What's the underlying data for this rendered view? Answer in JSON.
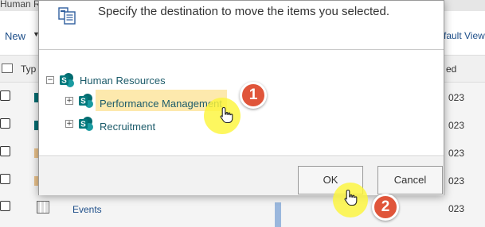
{
  "background": {
    "title_fragment": "Human R",
    "new_label": "New",
    "view_fragment": "fault View",
    "type_header": "Typ",
    "modified_header": "ed",
    "years": [
      "023",
      "023",
      "023",
      "023",
      "023"
    ],
    "events_label": "Events"
  },
  "dialog": {
    "instruction": "Specify the destination to move the items you selected.",
    "tree": {
      "root": {
        "label": "Human Resources",
        "expanded": true
      },
      "children": [
        {
          "label": "Performance Management",
          "selected": true
        },
        {
          "label": "Recruitment",
          "selected": false
        }
      ]
    },
    "ok_label": "OK",
    "cancel_label": "Cancel"
  },
  "annotations": {
    "step1": "1",
    "step2": "2"
  },
  "colors": {
    "selected_highlight": "#fde9ad",
    "step_badge": "#e0553a",
    "sharepoint_teal": "#036c70",
    "link_text": "#1c5b6a"
  }
}
